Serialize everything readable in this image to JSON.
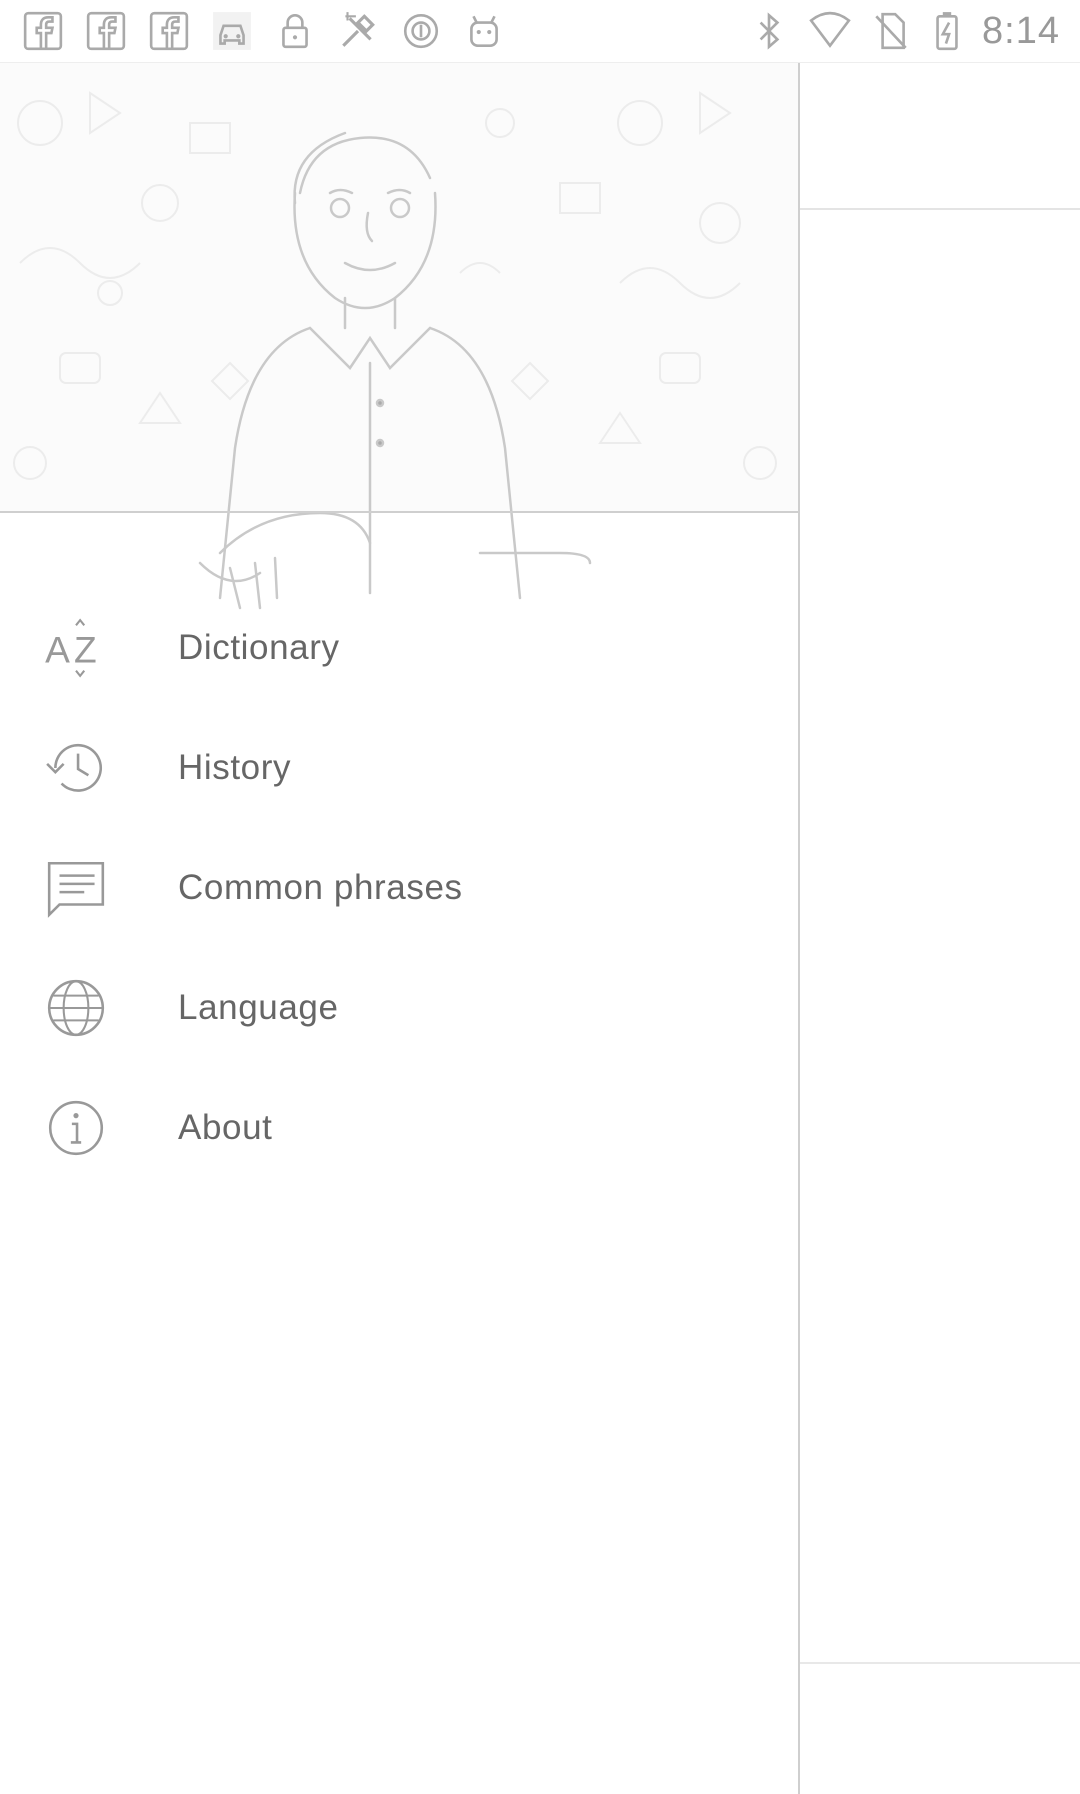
{
  "status_bar": {
    "time": "8:14",
    "left_icons": [
      "facebook-icon",
      "facebook-icon",
      "facebook-icon",
      "car-icon",
      "lock-icon",
      "tools-icon",
      "circle-badge-icon",
      "android-icon"
    ],
    "right_icons": [
      "bluetooth-icon",
      "wifi-icon",
      "no-sim-icon",
      "battery-charging-icon"
    ]
  },
  "drawer": {
    "menu": [
      {
        "label": "Dictionary",
        "icon": "az-sort-icon"
      },
      {
        "label": "History",
        "icon": "history-icon"
      },
      {
        "label": "Common phrases",
        "icon": "chat-icon"
      },
      {
        "label": "Language",
        "icon": "globe-icon"
      },
      {
        "label": "About",
        "icon": "info-icon"
      }
    ]
  },
  "colors": {
    "background": "#ffffff",
    "text": "#666666",
    "icon": "#9a9a9a",
    "divider": "#cfcfcf"
  }
}
